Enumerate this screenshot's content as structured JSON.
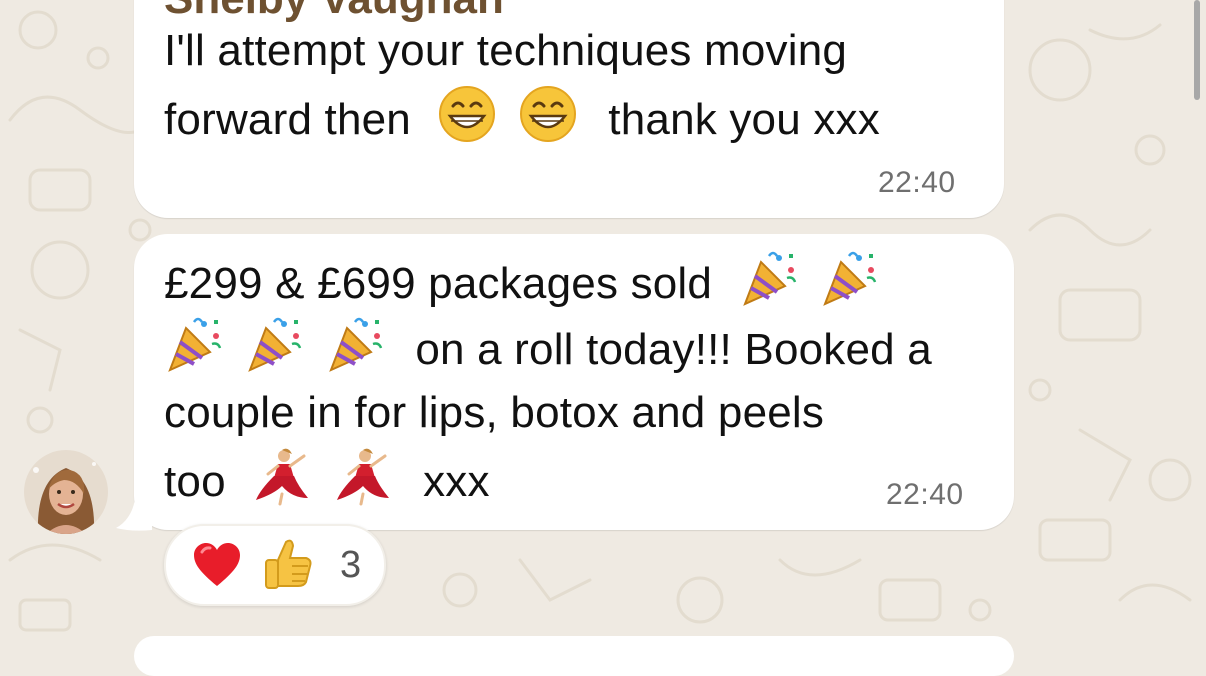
{
  "chat": {
    "messages": [
      {
        "sender_partial": "Shelby Vaughan",
        "lines": [
          "I'll attempt your techniques moving",
          "thank you xxx"
        ],
        "line2_prefix": "forward then",
        "time": "22:40"
      },
      {
        "lines": [
          "£299 & £699 packages sold",
          "on a roll today!!! Booked a",
          "couple in for lips, botox and peels",
          "too",
          "xxx"
        ],
        "time": "22:40",
        "reactions": {
          "emojis": [
            "heart-icon",
            "thumbs-up-icon"
          ],
          "count": "3"
        }
      }
    ]
  },
  "colors": {
    "wallpaper": "#efeae2",
    "bubble": "#ffffff",
    "timestamp": "#6f6f6f",
    "sender_name": "#6e5131"
  }
}
